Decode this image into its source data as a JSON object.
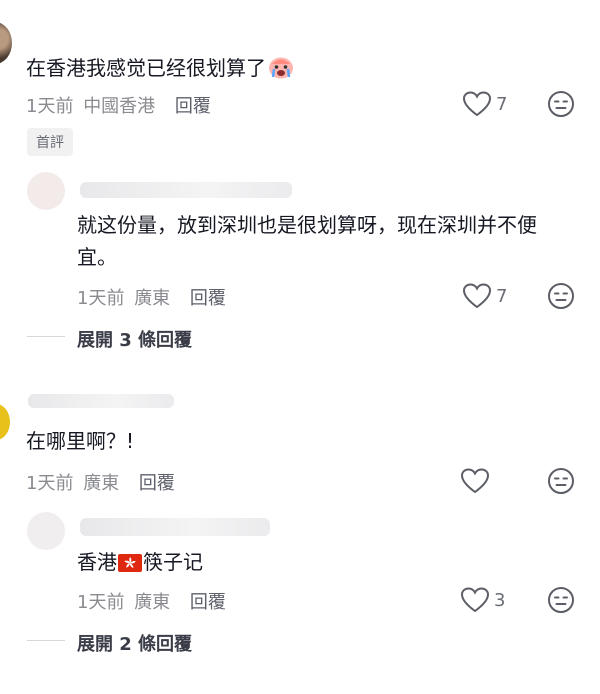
{
  "comments": [
    {
      "text": "在香港我感觉已经很划算了",
      "time": "1天前",
      "location": "中國香港",
      "reply_label": "回覆",
      "likes": "7",
      "badge": "首評",
      "emoji": "crying-face-icon",
      "replies": [
        {
          "text": "就这份量，放到深圳也是很划算呀，现在深圳并不便宜。",
          "time": "1天前",
          "location": "廣東",
          "reply_label": "回覆",
          "likes": "7"
        }
      ],
      "expand_label": "展開 3 條回覆"
    },
    {
      "text": "在哪里啊？!",
      "time": "1天前",
      "location": "廣東",
      "reply_label": "回覆",
      "likes": "",
      "replies": [
        {
          "text_before_flag": "香港",
          "flag": "hong-kong-flag-icon",
          "text_after_flag": "筷子记",
          "time": "1天前",
          "location": "廣東",
          "reply_label": "回覆",
          "likes": "3"
        }
      ],
      "expand_label": "展開 2 條回覆"
    }
  ],
  "colors": {
    "text": "#161823",
    "meta": "#8a8b91",
    "icon": "#5c5e67",
    "hk_flag_red": "#de2910"
  }
}
